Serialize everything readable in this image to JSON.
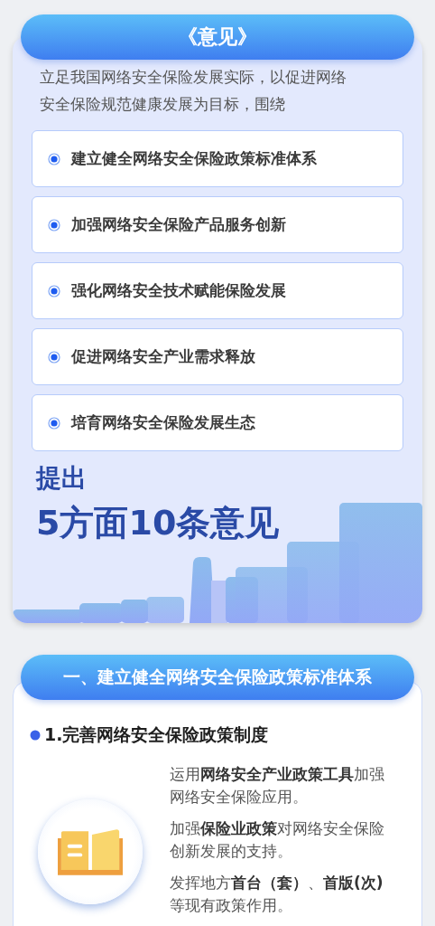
{
  "summary_card": {
    "title": "《意见》",
    "intro": "立足我国网络安全保险发展实际，以促进网络安全保险规范健康发展为目标，围绕",
    "items": [
      "建立健全网络安全保险政策标准体系",
      "加强网络安全保险产品服务创新",
      "强化网络安全技术赋能保险发展",
      "促进网络安全产业需求释放",
      "培育网络安全保险发展生态"
    ],
    "lead": "提出",
    "headline": "5方面10条意见"
  },
  "section": {
    "title": "一、建立健全网络安全保险政策标准体系",
    "subheading": "1.完善网络安全保险政策制度",
    "paragraphs": [
      "运用**网络安全产业政策工具**加强网络安全保险应用。",
      "加强**保险业政策**对网络安全保险创新发展的支持。",
      "发挥地方**首台（套）**、**首版(次)**等现有政策作用。"
    ]
  }
}
